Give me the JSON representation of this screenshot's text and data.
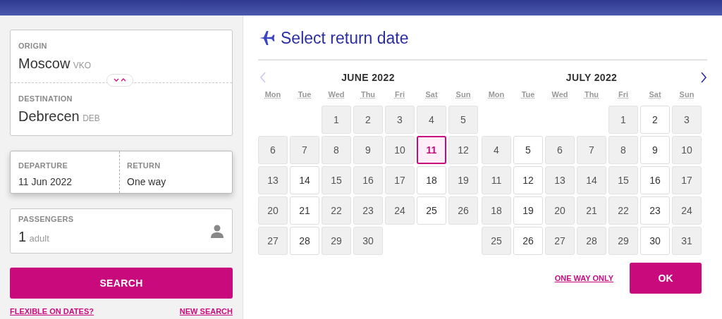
{
  "search_form": {
    "origin": {
      "label": "ORIGIN",
      "city": "Moscow",
      "code": "VKO"
    },
    "destination": {
      "label": "DESTINATION",
      "city": "Debrecen",
      "code": "DEB"
    },
    "departure": {
      "label": "DEPARTURE",
      "value": "11 Jun 2022"
    },
    "return": {
      "label": "RETURN",
      "value": "One way"
    },
    "passengers": {
      "label": "PASSENGERS",
      "count": "1",
      "unit": "adult"
    },
    "search_button": "SEARCH",
    "links": [
      "FLEXIBLE ON DATES?",
      "NEW SEARCH"
    ]
  },
  "calendar": {
    "title": "Select return date",
    "prev_disabled": true,
    "next_disabled": false,
    "months": [
      {
        "title": "JUNE 2022",
        "weekdays": [
          "Mon",
          "Tue",
          "Wed",
          "Thu",
          "Fri",
          "Sat",
          "Sun"
        ],
        "weeks": [
          [
            {
              "kind": "blank"
            },
            {
              "kind": "blank"
            },
            {
              "day": "1",
              "available": false,
              "selected": false
            },
            {
              "day": "2",
              "available": false,
              "selected": false
            },
            {
              "day": "3",
              "available": false,
              "selected": false
            },
            {
              "day": "4",
              "available": false,
              "selected": false
            },
            {
              "day": "5",
              "available": false,
              "selected": false
            }
          ],
          [
            {
              "day": "6",
              "available": false,
              "selected": false
            },
            {
              "day": "7",
              "available": false,
              "selected": false
            },
            {
              "day": "8",
              "available": false,
              "selected": false
            },
            {
              "day": "9",
              "available": false,
              "selected": false
            },
            {
              "day": "10",
              "available": false,
              "selected": false
            },
            {
              "day": "11",
              "selected": true
            },
            {
              "day": "12",
              "available": false,
              "selected": false
            }
          ],
          [
            {
              "day": "13",
              "available": false,
              "selected": false
            },
            {
              "day": "14",
              "available": true,
              "selected": false
            },
            {
              "day": "15",
              "available": false,
              "selected": false
            },
            {
              "day": "16",
              "available": false,
              "selected": false
            },
            {
              "day": "17",
              "available": false,
              "selected": false
            },
            {
              "day": "18",
              "available": true,
              "selected": false
            },
            {
              "day": "19",
              "available": false,
              "selected": false
            }
          ],
          [
            {
              "day": "20",
              "available": false,
              "selected": false
            },
            {
              "day": "21",
              "available": true,
              "selected": false
            },
            {
              "day": "22",
              "available": false,
              "selected": false
            },
            {
              "day": "23",
              "available": false,
              "selected": false
            },
            {
              "day": "24",
              "available": false,
              "selected": false
            },
            {
              "day": "25",
              "available": true,
              "selected": false
            },
            {
              "day": "26",
              "available": false,
              "selected": false
            }
          ],
          [
            {
              "day": "27",
              "available": false,
              "selected": false
            },
            {
              "day": "28",
              "available": true,
              "selected": false
            },
            {
              "day": "29",
              "available": false,
              "selected": false
            },
            {
              "day": "30",
              "available": false,
              "selected": false
            }
          ]
        ]
      },
      {
        "title": "JULY 2022",
        "weekdays": [
          "Mon",
          "Tue",
          "Wed",
          "Thu",
          "Fri",
          "Sat",
          "Sun"
        ],
        "weeks": [
          [
            {
              "kind": "blank"
            },
            {
              "kind": "blank"
            },
            {
              "kind": "blank"
            },
            {
              "kind": "blank"
            },
            {
              "day": "1",
              "available": false,
              "selected": false
            },
            {
              "day": "2",
              "available": true,
              "selected": false
            },
            {
              "day": "3",
              "available": false,
              "selected": false
            }
          ],
          [
            {
              "day": "4",
              "available": false,
              "selected": false
            },
            {
              "day": "5",
              "available": true,
              "selected": false
            },
            {
              "day": "6",
              "available": false,
              "selected": false
            },
            {
              "day": "7",
              "available": false,
              "selected": false
            },
            {
              "day": "8",
              "available": false,
              "selected": false
            },
            {
              "day": "9",
              "available": true,
              "selected": false
            },
            {
              "day": "10",
              "available": false,
              "selected": false
            }
          ],
          [
            {
              "day": "11",
              "available": false,
              "selected": false
            },
            {
              "day": "12",
              "available": true,
              "selected": false
            },
            {
              "day": "13",
              "available": false,
              "selected": false
            },
            {
              "day": "14",
              "available": false,
              "selected": false
            },
            {
              "day": "15",
              "available": false,
              "selected": false
            },
            {
              "day": "16",
              "available": true,
              "selected": false
            },
            {
              "day": "17",
              "available": false,
              "selected": false
            }
          ],
          [
            {
              "day": "18",
              "available": false,
              "selected": false
            },
            {
              "day": "19",
              "available": true,
              "selected": false
            },
            {
              "day": "20",
              "available": false,
              "selected": false
            },
            {
              "day": "21",
              "available": false,
              "selected": false
            },
            {
              "day": "22",
              "available": false,
              "selected": false
            },
            {
              "day": "23",
              "available": true,
              "selected": false
            },
            {
              "day": "24",
              "available": false,
              "selected": false
            }
          ],
          [
            {
              "day": "25",
              "available": false,
              "selected": false
            },
            {
              "day": "26",
              "available": true,
              "selected": false
            },
            {
              "day": "27",
              "available": false,
              "selected": false
            },
            {
              "day": "28",
              "available": false,
              "selected": false
            },
            {
              "day": "29",
              "available": false,
              "selected": false
            },
            {
              "day": "30",
              "available": true,
              "selected": false
            },
            {
              "day": "31",
              "available": false,
              "selected": false
            }
          ]
        ]
      }
    ],
    "one_way_link": "ONE WAY ONLY",
    "ok_button": "OK"
  }
}
